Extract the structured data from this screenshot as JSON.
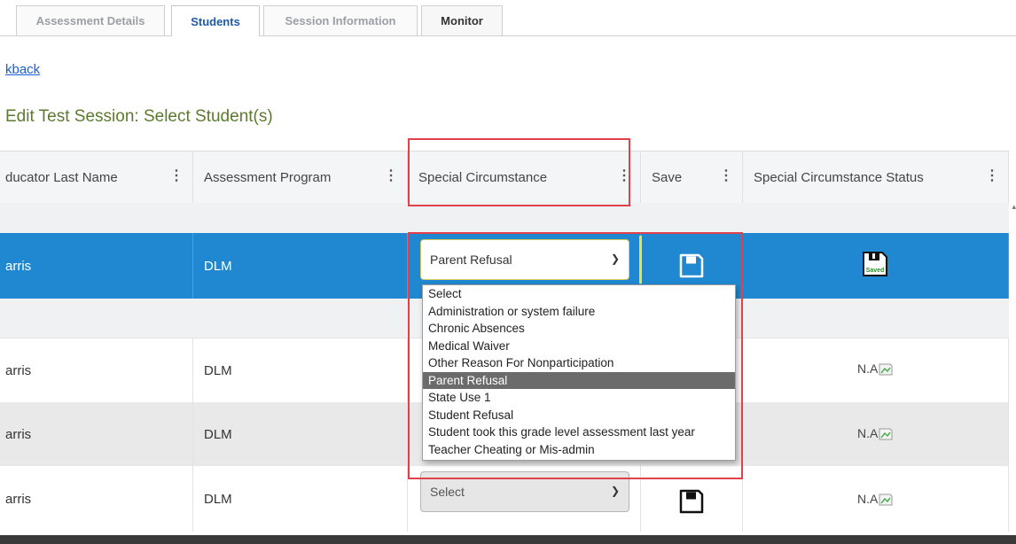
{
  "tabs": [
    {
      "label": "Assessment Details",
      "active": false
    },
    {
      "label": "Students",
      "active": true
    },
    {
      "label": "Session Information",
      "active": false
    },
    {
      "label": "Monitor",
      "active": false
    }
  ],
  "back_link": "<back",
  "back_link_visible": "kback",
  "page_title": "Edit Test Session: Select Student(s)",
  "columns": [
    {
      "label": "ducator Last Name"
    },
    {
      "label": "Assessment Program"
    },
    {
      "label": "Special Circumstance"
    },
    {
      "label": "Save"
    },
    {
      "label": "Special Circumstance Status"
    }
  ],
  "rows": [
    {
      "educator": "arris",
      "program": "DLM",
      "circumstance": "Parent Refusal",
      "status": "Saved",
      "selected": true
    },
    {
      "educator": "arris",
      "program": "DLM",
      "status": "N.A"
    },
    {
      "educator": "arris",
      "program": "DLM",
      "status": "N.A"
    },
    {
      "educator": "arris",
      "program": "DLM",
      "circumstance": "Select",
      "status": "N.A"
    }
  ],
  "dropdown": {
    "selected": "Parent Refusal",
    "options": [
      "Select",
      "Administration or system failure",
      "Chronic Absences",
      "Medical Waiver",
      "Other Reason For Nonparticipation",
      "Parent Refusal",
      "State Use 1",
      "Student Refusal",
      "Student took this grade level assessment last year",
      "Teacher Cheating or Mis-admin"
    ]
  },
  "colors": {
    "selected_row": "#1f88d0",
    "title_green": "#5c7a2e",
    "annotation_red": "#e0414b",
    "link_blue": "#1a5fd6"
  },
  "icons": {
    "save": "floppy-disk-icon",
    "saved": "floppy-disk-saved-icon",
    "kebab": "vertical-ellipsis-icon",
    "chevron": "chevron-down-icon"
  }
}
